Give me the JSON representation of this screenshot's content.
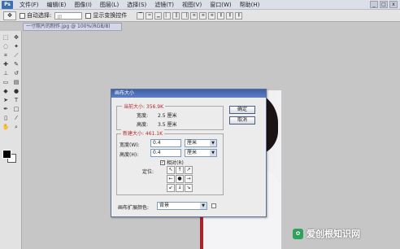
{
  "app": {
    "logo": "Ps"
  },
  "menubar": {
    "items": [
      "文件(F)",
      "编辑(E)",
      "图像(I)",
      "图层(L)",
      "选择(S)",
      "滤镜(T)",
      "视图(V)",
      "窗口(W)",
      "帮助(H)"
    ]
  },
  "window_controls": {
    "minimize": "_",
    "maximize": "□",
    "close": "x"
  },
  "options_bar": {
    "auto_select_label": "自动选择:",
    "auto_select_value": "组",
    "show_transform_label": "显示变换控件"
  },
  "document": {
    "tab_title": "一寸照片的制作.jpg @ 100%(RGB/8)"
  },
  "dialog": {
    "title": "画布大小",
    "current_size": {
      "legend": "当前大小: 356.9K",
      "width_label": "宽度:",
      "width_value": "2.5 厘米",
      "height_label": "高度:",
      "height_value": "3.5 厘米"
    },
    "new_size": {
      "legend": "新建大小: 461.1K",
      "width_label": "宽度(W):",
      "width_value": "0.4",
      "width_unit": "厘米",
      "height_label": "高度(H):",
      "height_value": "0.4",
      "height_unit": "厘米",
      "relative_label": "相对(R)",
      "relative_checked": true,
      "anchor_label": "定位:"
    },
    "ok_button": "确定",
    "cancel_button": "取消",
    "extension_color_label": "画布扩展颜色:",
    "extension_color_value": "背景"
  },
  "watermark": {
    "text": "爱创根知识网"
  }
}
